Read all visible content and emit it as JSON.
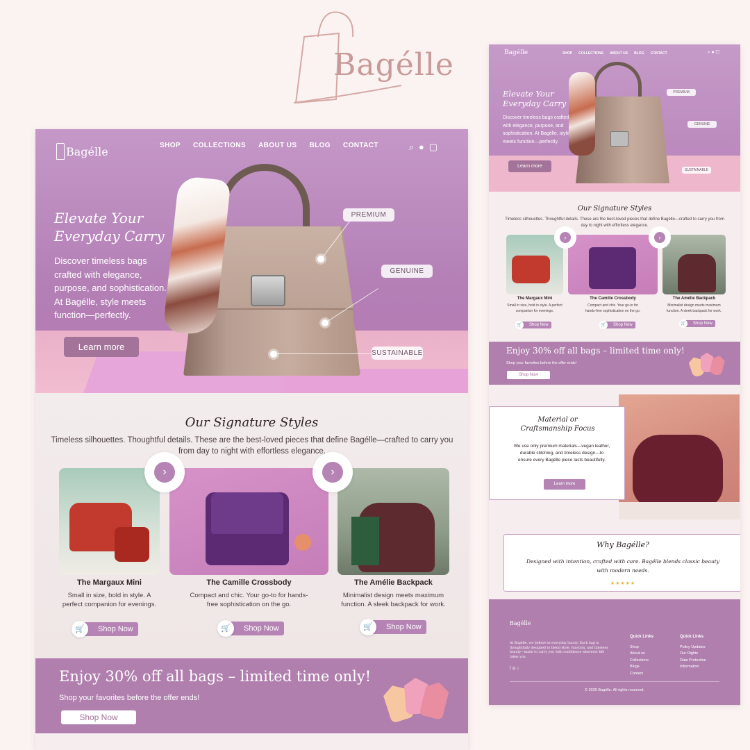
{
  "brand": {
    "name": "Bagélle",
    "logo_text": "Bagélle"
  },
  "nav": {
    "links": [
      "SHOP",
      "COLLECTIONS",
      "ABOUT US",
      "BLOG",
      "CONTACT"
    ],
    "icons": [
      "search-icon",
      "user-icon",
      "cart-icon"
    ]
  },
  "hero": {
    "title_line1": "Elevate Your",
    "title_line2": "Everyday Carry",
    "description": "Discover timeless bags crafted with elegance, purpose, and sophistication. At Bagélle, style meets function—perfectly.",
    "button": "Learn more",
    "callouts": [
      "PREMIUM",
      "GENUINE",
      "SUSTAINABLE"
    ]
  },
  "signature": {
    "title": "Our Signature Styles",
    "subtitle": "Timeless silhouettes. Thoughtful details. These are the best-loved pieces that define Bagélle—crafted to carry you from day to night with effortless elegance.",
    "products": [
      {
        "name": "The Margaux Mini",
        "desc": "Small in size, bold in style. A perfect companion for evenings.",
        "button": "Shop Now",
        "color": "#c23a2e"
      },
      {
        "name": "The Camille Crossbody",
        "desc": "Compact and chic. Your go-to for hands-free sophistication on the go.",
        "button": "Shop Now",
        "color": "#5c2a73"
      },
      {
        "name": "The Amélie Backpack",
        "desc": "Minimalist design meets maximum function. A sleek backpack for work.",
        "button": "Shop Now",
        "color": "#5d2a30"
      }
    ]
  },
  "promo": {
    "title": "Enjoy 30% off all bags – limited time only!",
    "subtitle": "Shop your favorites before the offer ends!",
    "button": "Shop Now"
  },
  "material": {
    "title_line1": "Material or",
    "title_line2": "Craftsmanship Focus",
    "description": "We use only premium materials—vegan leather, durable stitching, and timeless design—to ensure every Bagélle piece lasts beautifully.",
    "button": "Learn more"
  },
  "why": {
    "title": "Why Bagélle?",
    "description": "Designed with intention, crafted with care. Bagélle blends classic beauty with modern needs.",
    "stars": "★★★★★"
  },
  "footer": {
    "about": "At Bagélle, we believe in everyday luxury. Each bag is thoughtfully designed to blend style, function, and timeless beauty—made to carry you with confidence wherever life takes you.",
    "col1_title": "Quick Links",
    "col1_links": [
      "Shop",
      "About us",
      "Collections",
      "Blogs",
      "Contact"
    ],
    "col2_title": "Quick Links",
    "col2_links": [
      "Policy Updates",
      "Our Rights",
      "Data Protection",
      "Information"
    ],
    "social": "f ◎ ♪",
    "copyright": "© 2025 Bagélle. All rights reserved."
  },
  "colors": {
    "accent": "#b584b5",
    "hero": "#c598c8",
    "promo": "#b07fae",
    "brand_logo": "#c79a98"
  }
}
